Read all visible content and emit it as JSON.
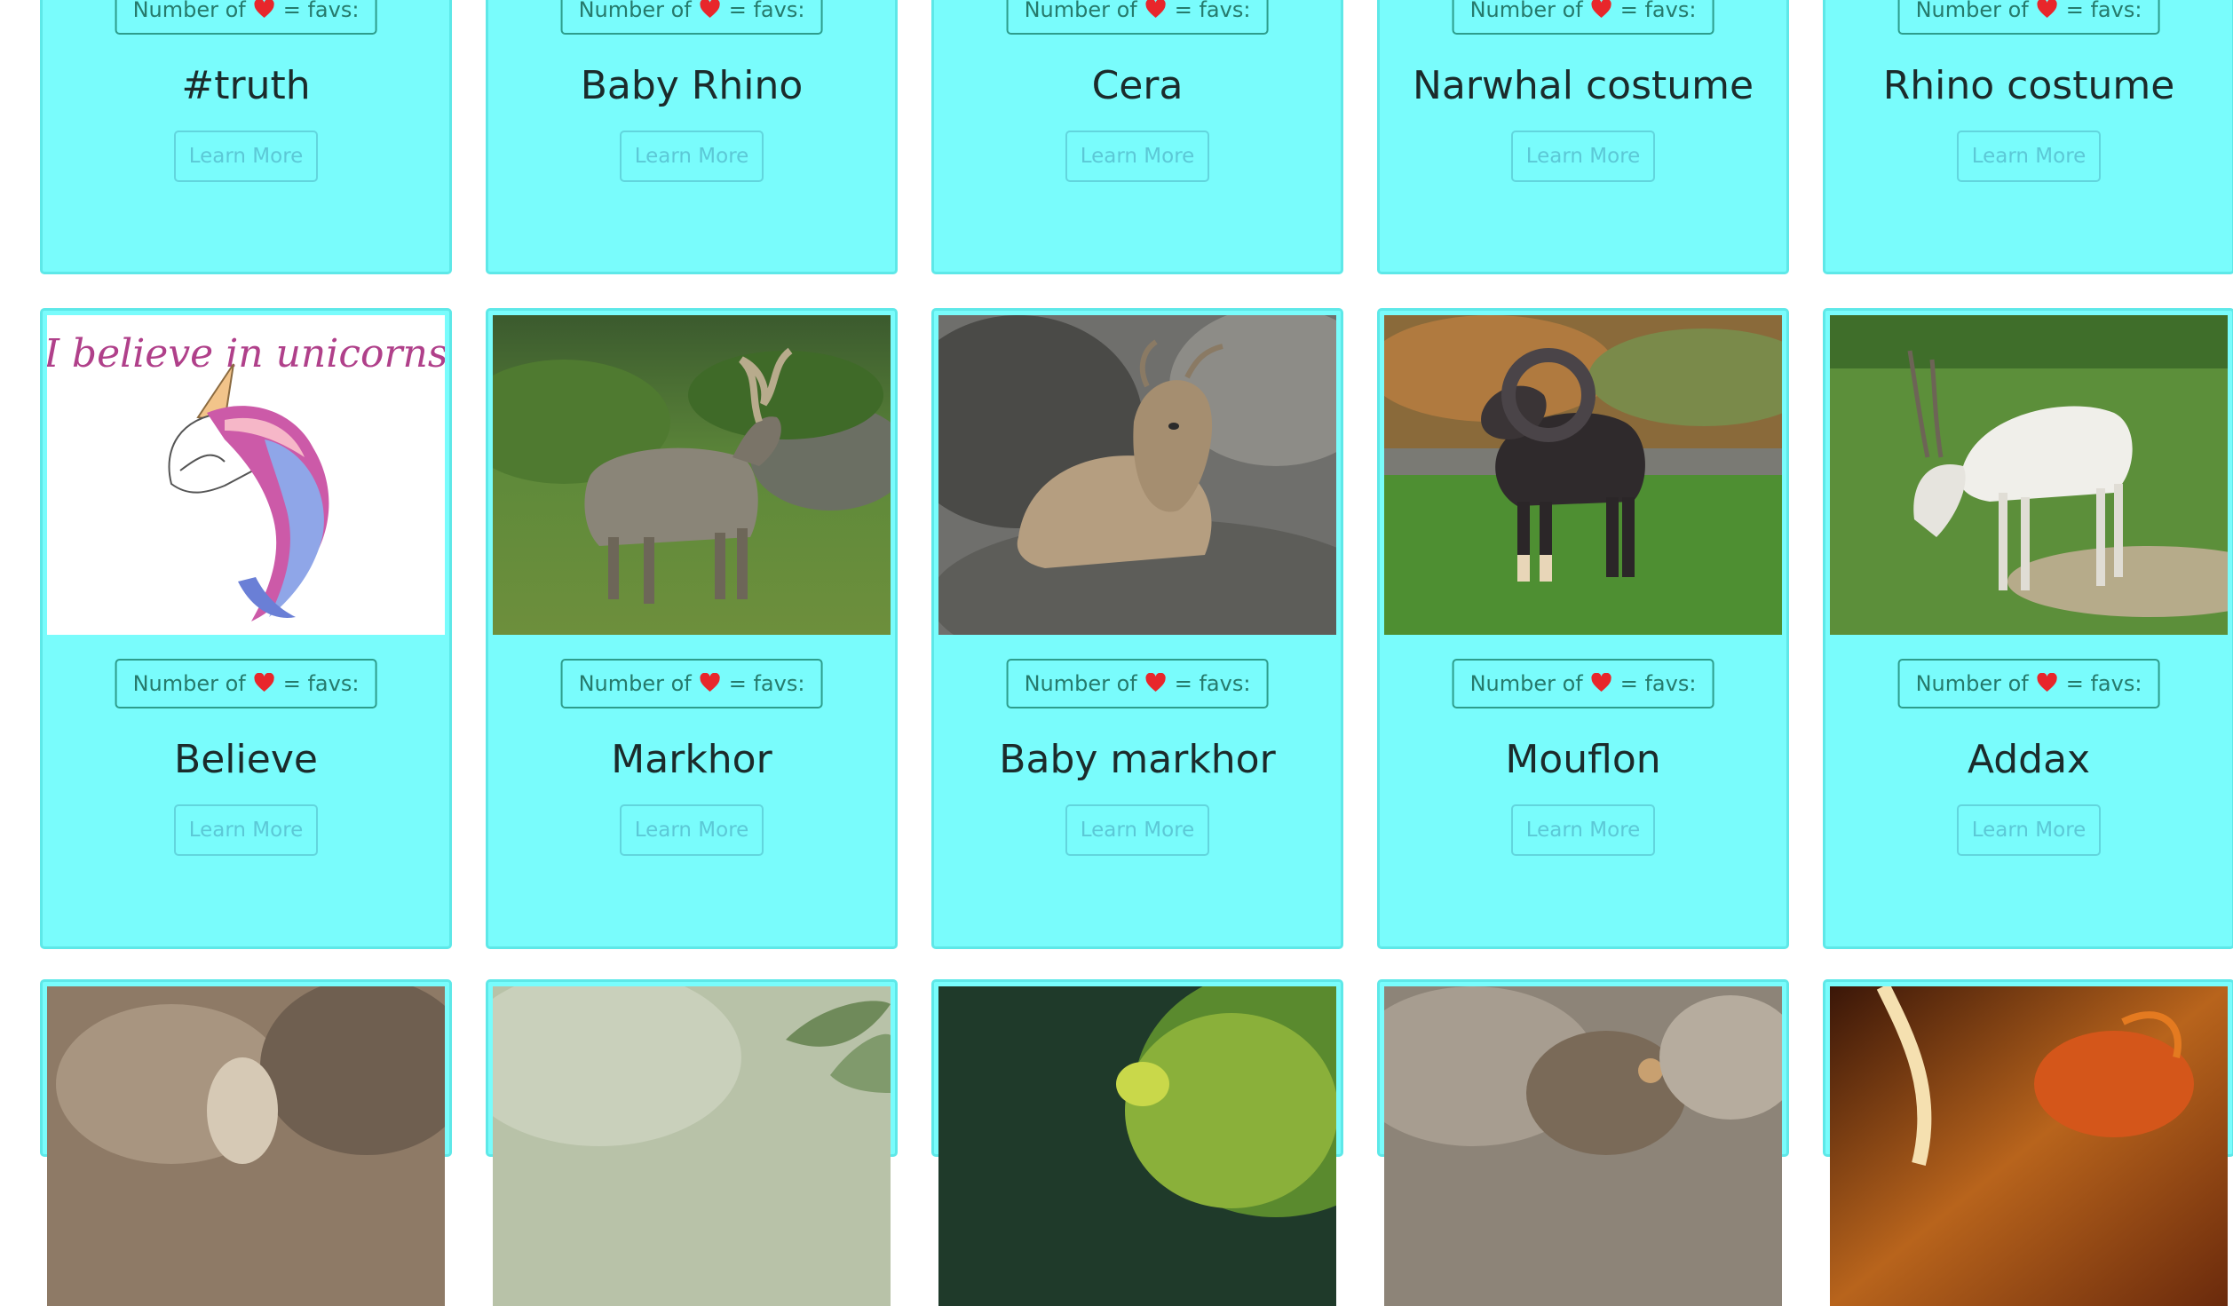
{
  "fav_label_prefix": "Number of",
  "fav_label_suffix": "= favs:",
  "learn_more_label": "Learn More",
  "colors": {
    "card_background": "#79fcfc",
    "card_border": "#5ee8e8",
    "heart": "#e8262b",
    "badge_border": "#2e9d8c",
    "button_text": "#5cc8d6"
  },
  "rows": [
    {
      "cards": [
        {
          "title": "#truth"
        },
        {
          "title": "Baby Rhino"
        },
        {
          "title": "Cera"
        },
        {
          "title": "Narwhal costume"
        },
        {
          "title": "Rhino costume"
        }
      ]
    },
    {
      "cards": [
        {
          "title": "Believe",
          "image": "unicorn-illustration",
          "image_text": "I believe in unicorns"
        },
        {
          "title": "Markhor",
          "image": "markhor-photo"
        },
        {
          "title": "Baby markhor",
          "image": "baby-markhor-photo"
        },
        {
          "title": "Mouflon",
          "image": "mouflon-photo"
        },
        {
          "title": "Addax",
          "image": "addax-photo"
        }
      ]
    },
    {
      "cards": [
        {
          "image": "brown-animal-photo"
        },
        {
          "image": "green-leaves-photo"
        },
        {
          "image": "chameleon-photo"
        },
        {
          "image": "toad-photo"
        },
        {
          "image": "dragon-illustration"
        }
      ]
    }
  ]
}
